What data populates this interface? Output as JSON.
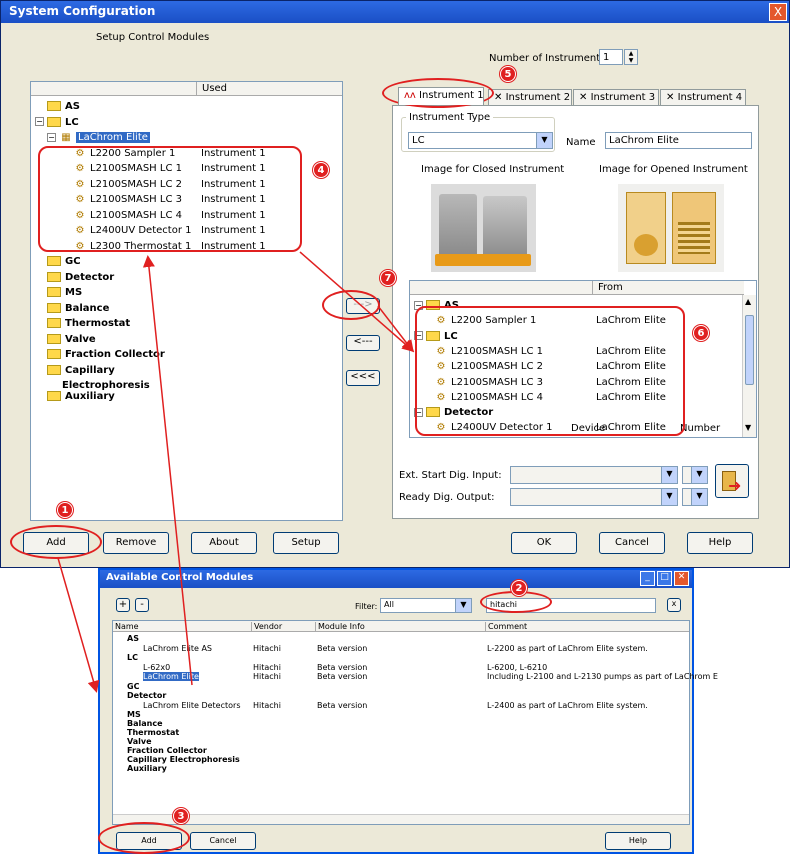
{
  "main_window": {
    "title": "System Configuration",
    "close_label": "X",
    "setup_control_modules": "Setup Control Modules",
    "used_header": "Used",
    "num_instruments_label": "Number of Instruments:",
    "num_instruments_value": "1",
    "left_tree": [
      {
        "label": "AS",
        "type": "folder"
      },
      {
        "label": "LC",
        "type": "folder"
      },
      {
        "label": "LaChrom Elite",
        "type": "selected"
      },
      {
        "label": "L2200 Sampler 1",
        "used": "Instrument 1"
      },
      {
        "label": "L2100SMASH LC 1",
        "used": "Instrument 1"
      },
      {
        "label": "L2100SMASH LC 2",
        "used": "Instrument 1"
      },
      {
        "label": "L2100SMASH LC 3",
        "used": "Instrument 1"
      },
      {
        "label": "L2100SMASH LC 4",
        "used": "Instrument 1"
      },
      {
        "label": "L2400UV Detector 1",
        "used": "Instrument 1"
      },
      {
        "label": "L2300 Thermostat 1",
        "used": "Instrument 1"
      },
      {
        "label": "GC",
        "type": "folder"
      },
      {
        "label": "Detector",
        "type": "folder"
      },
      {
        "label": "MS",
        "type": "folder"
      },
      {
        "label": "Balance",
        "type": "folder"
      },
      {
        "label": "Thermostat",
        "type": "folder"
      },
      {
        "label": "Valve",
        "type": "folder"
      },
      {
        "label": "Fraction Collector",
        "type": "folder"
      },
      {
        "label": "Capillary",
        "type": "folder"
      },
      {
        "label": "Electrophoresis",
        "type": "cont"
      },
      {
        "label": "Auxiliary",
        "type": "folder"
      }
    ],
    "tabs": [
      "Instrument 1",
      "Instrument 2",
      "Instrument 3",
      "Instrument 4"
    ],
    "instrument_type_label": "Instrument Type",
    "instrument_type_value": "LC",
    "name_label": "Name",
    "name_value": "LaChrom Elite",
    "img_closed_label": "Image for Closed Instrument",
    "img_opened_label": "Image for Opened Instrument",
    "from_header": "From",
    "right_tree": [
      {
        "label": "AS",
        "type": "folder"
      },
      {
        "label": "L2200 Sampler 1",
        "from": "LaChrom Elite"
      },
      {
        "label": "LC",
        "type": "folder"
      },
      {
        "label": "L2100SMASH LC 1",
        "from": "LaChrom Elite"
      },
      {
        "label": "L2100SMASH LC 2",
        "from": "LaChrom Elite"
      },
      {
        "label": "L2100SMASH LC 3",
        "from": "LaChrom Elite"
      },
      {
        "label": "L2100SMASH LC 4",
        "from": "LaChrom Elite"
      },
      {
        "label": "Detector",
        "type": "folder"
      },
      {
        "label": "L2400UV Detector 1",
        "from": "LaChrom Elite"
      }
    ],
    "arrow_right": "--->",
    "arrow_left": "<---",
    "arrow_all_left": "<<<",
    "device_header": "Device",
    "number_header": "Number",
    "ext_start": "Ext. Start Dig. Input:",
    "ready_dig": "Ready Dig. Output:",
    "buttons": {
      "add": "Add",
      "remove": "Remove",
      "about": "About",
      "setup": "Setup",
      "ok": "OK",
      "cancel": "Cancel",
      "help": "Help"
    }
  },
  "dialog": {
    "title": "Available Control Modules",
    "plus": "+",
    "minus": "-",
    "filter_label": "Filter:",
    "filter_value": "All",
    "search_value": "hitachi",
    "search_clear": "x",
    "cols": [
      "Name",
      "Vendor",
      "Module Info",
      "Comment"
    ],
    "rows": [
      {
        "name": "AS",
        "vendor": "",
        "info": "",
        "comment": "",
        "bold": true
      },
      {
        "name": "LaChrom Elite AS",
        "vendor": "Hitachi",
        "info": "Beta version",
        "comment": "L-2200 as part of LaChrom Elite system."
      },
      {
        "name": "LC",
        "vendor": "",
        "info": "",
        "comment": "",
        "bold": true
      },
      {
        "name": "L-62x0",
        "vendor": "Hitachi",
        "info": "Beta version",
        "comment": "L-6200, L-6210"
      },
      {
        "name": "LaChrom Elite",
        "vendor": "Hitachi",
        "info": "Beta version",
        "comment": "Including L-2100 and L-2130 pumps as part of LaChrom E"
      },
      {
        "name": "GC",
        "vendor": "",
        "info": "",
        "comment": "",
        "bold": true
      },
      {
        "name": "Detector",
        "vendor": "",
        "info": "",
        "comment": "",
        "bold": true
      },
      {
        "name": "LaChrom Elite Detectors",
        "vendor": "Hitachi",
        "info": "Beta version",
        "comment": "L-2400 as part of LaChrom Elite system."
      },
      {
        "name": "MS",
        "bold": true
      },
      {
        "name": "Balance",
        "bold": true
      },
      {
        "name": "Thermostat",
        "bold": true
      },
      {
        "name": "Valve",
        "bold": true
      },
      {
        "name": "Fraction Collector",
        "bold": true
      },
      {
        "name": "Capillary Electrophoresis",
        "bold": true
      },
      {
        "name": "Auxiliary",
        "bold": true
      }
    ],
    "add": "Add",
    "cancel": "Cancel",
    "help": "Help"
  },
  "callouts": [
    "1",
    "2",
    "3",
    "4",
    "5",
    "6",
    "7"
  ]
}
